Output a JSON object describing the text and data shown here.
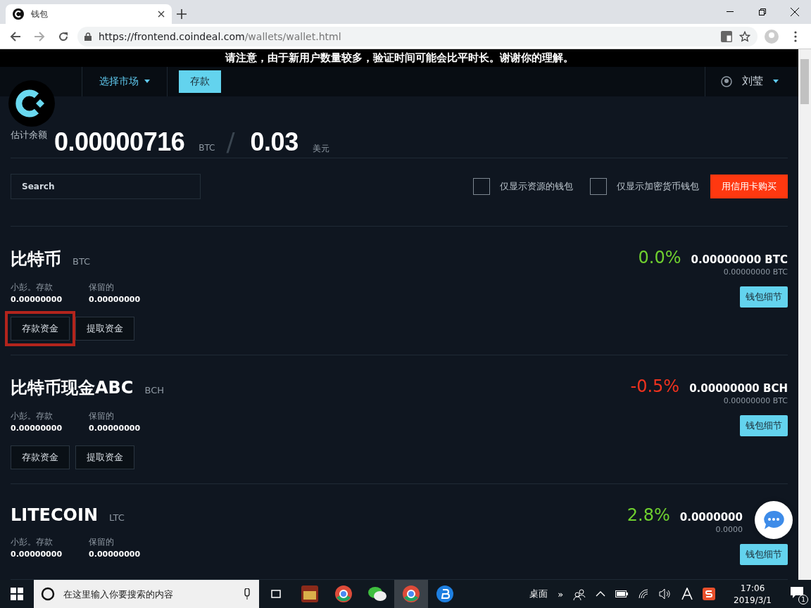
{
  "browser": {
    "tab": {
      "title": "钱包"
    },
    "url": {
      "host": "https://frontend.coindeal.com",
      "path": "/wallets/wallet.html"
    }
  },
  "notice": "请注意，由于新用户数量较多，验证时间可能会比平时长。谢谢你的理解。",
  "nav": {
    "market": "选择市场",
    "deposit": "存款",
    "user": "刘莹"
  },
  "balance": {
    "label": "估计余额",
    "btc": "0.00000716",
    "btc_unit": "BTC",
    "separator": "/",
    "fiat": "0.03",
    "fiat_unit": "美元"
  },
  "filters": {
    "search": {
      "placeholder": "Search"
    },
    "checkboxes": [
      {
        "label": "仅显示资源的钱包",
        "checked": false
      },
      {
        "label": "仅显示加密货币钱包",
        "checked": false
      }
    ],
    "buy": "用信用卡购买"
  },
  "wallets": [
    {
      "name": "比特币",
      "code": "BTC",
      "available_label": "小彭。存款",
      "available": "0.00000000",
      "reserved_label": "保留的",
      "reserved": "0.00000000",
      "change": "0.0%",
      "color": "#6fcf2f",
      "amount": "0.00000000 BTC",
      "amount_btc": "0.00000000 BTC",
      "details": "钱包细节",
      "deposit": "存款资金",
      "withdraw": "提取资金",
      "highlighted": true
    },
    {
      "name": "比特币现金ABC",
      "code": "BCH",
      "available_label": "小彭。存款",
      "available": "0.00000000",
      "reserved_label": "保留的",
      "reserved": "0.00000000",
      "change": "-0.5%",
      "color": "#f0321e",
      "amount": "0.00000000 BCH",
      "amount_btc": "0.00000000 BTC",
      "details": "钱包细节",
      "deposit": "存款资金",
      "withdraw": "提取资金",
      "highlighted": false
    },
    {
      "name": "LITECOIN",
      "code": "LTC",
      "available_label": "小彭。存款",
      "available": "0.00000000",
      "reserved_label": "保留的",
      "reserved": "0.00000000",
      "change": "2.8%",
      "color": "#6fcf2f",
      "amount": "0.0000000",
      "amount_btc": "0.0000",
      "details": "钱包细节"
    }
  ],
  "taskbar": {
    "search": {
      "placeholder": "在这里输入你要搜索的内容"
    },
    "desktop": "桌面",
    "more": "»",
    "time": "17:06",
    "date": "2019/3/1",
    "notifications": "1"
  }
}
